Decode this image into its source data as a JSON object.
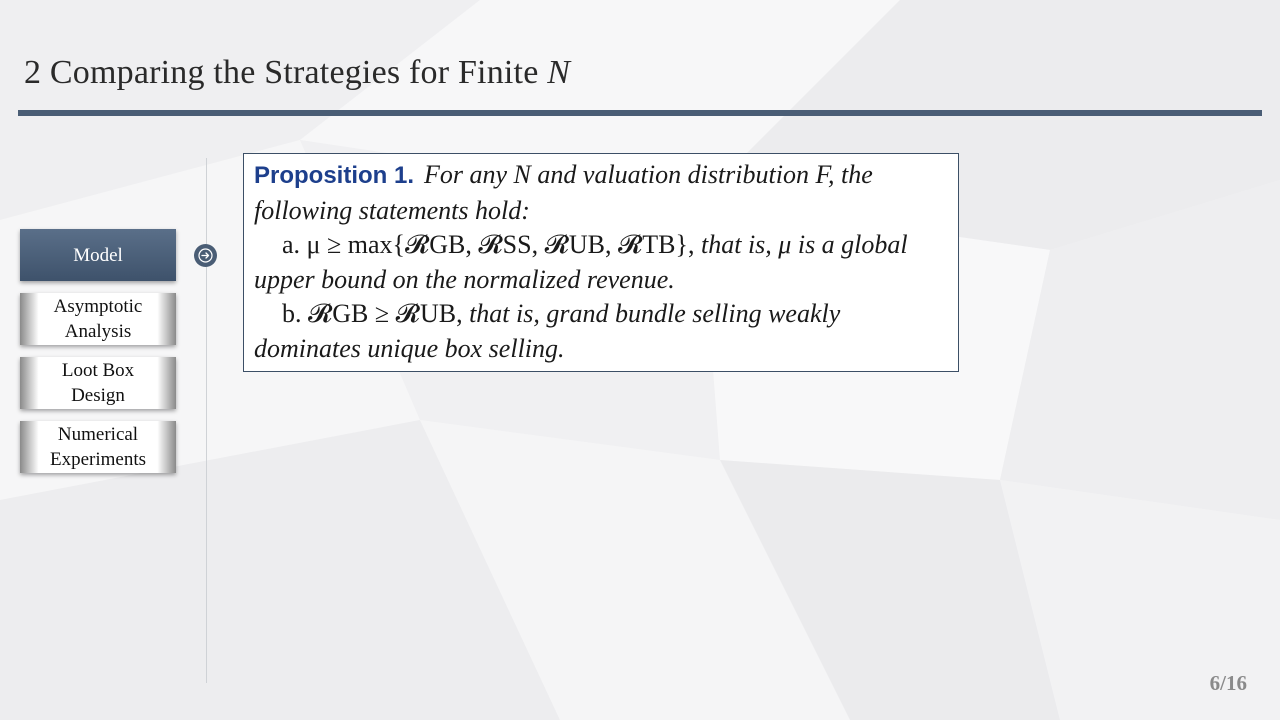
{
  "slide": {
    "section_number": "2",
    "title_text": "Comparing the Strategies for Finite",
    "title_var": "N"
  },
  "nav": {
    "items": [
      {
        "label": "Model",
        "active": true
      },
      {
        "label": "Asymptotic Analysis",
        "active": false
      },
      {
        "label": "Loot Box Design",
        "active": false
      },
      {
        "label": "Numerical Experiments",
        "active": false
      }
    ]
  },
  "proposition": {
    "heading": "Proposition 1.",
    "line1": "For any N and valuation distribution F, the",
    "line2": "following statements hold:",
    "item_a_label": "a.",
    "item_a_math": "μ ≥ max{𝓡GB, 𝓡SS, 𝓡UB, 𝓡TB},",
    "item_a_text": "that is, μ is a global",
    "line4": "upper bound on the normalized revenue.",
    "item_b_label": "b.",
    "item_b_math": "𝓡GB ≥ 𝓡UB,",
    "item_b_text": "that is, grand bundle selling weakly",
    "line6": "dominates unique box selling."
  },
  "footer": {
    "page_number": "6/16"
  },
  "colors": {
    "accent": "#4a5d75",
    "proposition_heading": "#1d3f8c",
    "nav_active": "#3e526b"
  }
}
